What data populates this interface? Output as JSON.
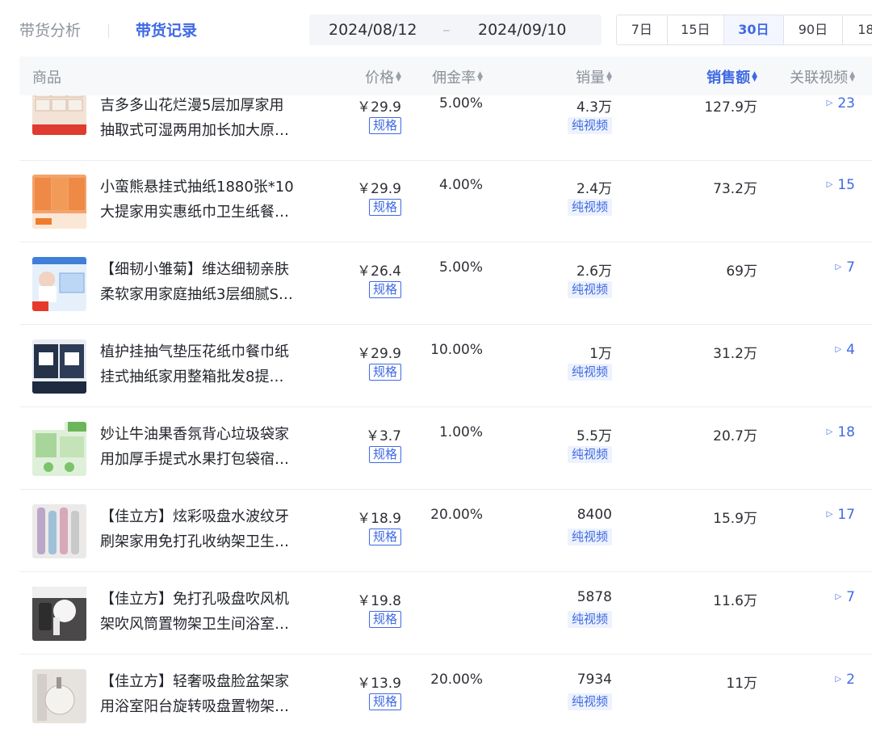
{
  "header": {
    "tabs": [
      "带货分析",
      "带货记录"
    ],
    "date_start": "2024/08/12",
    "date_sep": "–",
    "date_end": "2024/09/10",
    "ranges": [
      "7日",
      "15日",
      "30日",
      "90日",
      "18"
    ],
    "active_range": "30日"
  },
  "table": {
    "columns": [
      "商品",
      "价格",
      "佣金率",
      "销量",
      "销售额",
      "关联视频"
    ],
    "sorted_column": "销售额",
    "spec_label": "规格",
    "pure_video_label": "纯视频",
    "rows": [
      {
        "name1": "吉多多山花烂漫5层加厚家用",
        "name2": "抽取式可湿两用加长加大原…",
        "price": "￥29.9",
        "commission": "5.00%",
        "sales": "4.3万",
        "amount": "127.9万",
        "videos": "23",
        "thumb": "tissue-pink"
      },
      {
        "name1": "小蛮熊悬挂式抽纸1880张*10",
        "name2": "大提家用实惠纸巾卫生纸餐…",
        "price": "￥29.9",
        "commission": "4.00%",
        "sales": "2.4万",
        "amount": "73.2万",
        "videos": "15",
        "thumb": "tissue-orange"
      },
      {
        "name1": "【细韧小雏菊】维达细韧亲肤",
        "name2": "柔软家用家庭抽纸3层细腻S…",
        "price": "￥26.4",
        "commission": "5.00%",
        "sales": "2.6万",
        "amount": "69万",
        "videos": "7",
        "thumb": "tissue-blue"
      },
      {
        "name1": "植护挂抽气垫压花纸巾餐巾纸",
        "name2": "挂式抽纸家用整箱批发8提…",
        "price": "￥29.9",
        "commission": "10.00%",
        "sales": "1万",
        "amount": "31.2万",
        "videos": "4",
        "thumb": "tissue-dark"
      },
      {
        "name1": "妙让牛油果香氛背心垃圾袋家",
        "name2": "用加厚手提式水果打包袋宿…",
        "price": "￥3.7",
        "commission": "1.00%",
        "sales": "5.5万",
        "amount": "20.7万",
        "videos": "18",
        "thumb": "bags-green"
      },
      {
        "name1": "【佳立方】炫彩吸盘水波纹牙",
        "name2": "刷架家用免打孔收纳架卫生…",
        "price": "￥18.9",
        "commission": "20.00%",
        "sales": "8400",
        "amount": "15.9万",
        "videos": "17",
        "thumb": "toothbrush-holder"
      },
      {
        "name1": "【佳立方】免打孔吸盘吹风机",
        "name2": "架吹风筒置物架卫生间浴室…",
        "price": "￥19.8",
        "commission": "",
        "sales": "5878",
        "amount": "11.6万",
        "videos": "7",
        "thumb": "hairdryer-rack"
      },
      {
        "name1": "【佳立方】轻奢吸盘脸盆架家",
        "name2": "用浴室阳台旋转吸盘置物架…",
        "price": "￥13.9",
        "commission": "20.00%",
        "sales": "7934",
        "amount": "11万",
        "videos": "2",
        "thumb": "basin-rack"
      }
    ]
  },
  "colors": {
    "accent": "#3f6ae3",
    "muted": "#8a9099",
    "tag_bg": "#edf2fd"
  }
}
